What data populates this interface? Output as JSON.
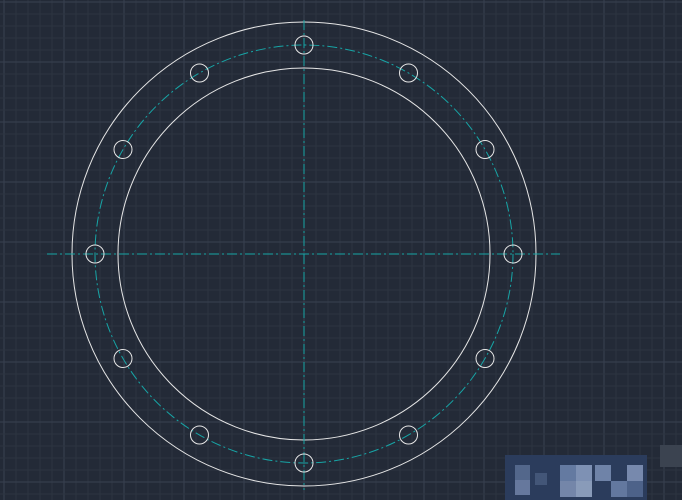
{
  "viewport": {
    "background": "#232a37",
    "grid_minor": "#2c3441",
    "grid_major": "#384151",
    "grid_visible": true
  },
  "drawing": {
    "entities": [
      "outer-circle",
      "inner-circle",
      "bolt-circle-centerline",
      "horizontal-centerline",
      "vertical-centerline",
      "bolt-holes"
    ],
    "bolt_hole_count": 12,
    "outline_color": "#e6e6e6",
    "centerline_color": "#17a5a6"
  },
  "overlay": {
    "watermark": "pixelated-watermark",
    "watermark_color": "#2b3c5c"
  }
}
